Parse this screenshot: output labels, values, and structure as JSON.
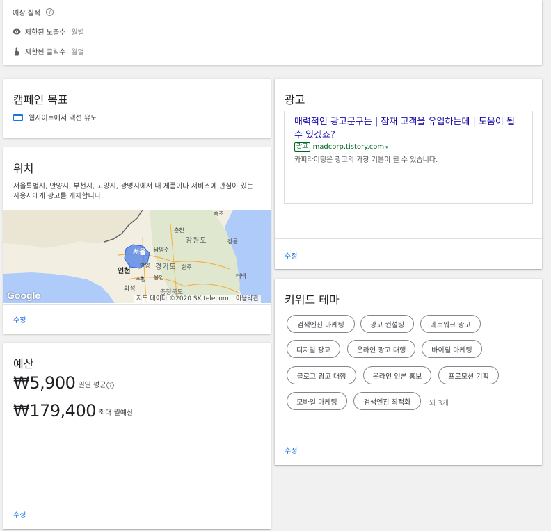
{
  "forecast": {
    "title": "예상 실적",
    "help": "?",
    "rows": [
      {
        "label": "제한된 노출수",
        "sub": "월별",
        "icon": "eye-icon"
      },
      {
        "label": "제한된 클릭수",
        "sub": "월별",
        "icon": "pointer-hand-icon"
      }
    ]
  },
  "goal": {
    "title": "캠페인 목표",
    "item": "웹사이트에서 액션 유도",
    "icon": "website-icon"
  },
  "location": {
    "title": "위치",
    "description": "서울특별시, 안양시, 부천시, 고양시, 광명시에서 내 제품이나 서비스에 관심이 있는 사용자에게 광고를 게재합니다.",
    "map": {
      "logo": "Google",
      "attribution": "지도 데이터 ©2020 SK telecom",
      "terms": "이용약관",
      "labels": [
        "속초",
        "춘천",
        "강원도",
        "강릉",
        "서울",
        "남양주",
        "인천",
        "안양",
        "경기도",
        "원주",
        "수원",
        "용인",
        "화성",
        "충청북도",
        "태백"
      ]
    },
    "edit": "수정"
  },
  "budget": {
    "title": "예산",
    "daily_amount": "₩5,900",
    "daily_note": "일일 평균",
    "help": "?",
    "monthly_amount": "₩179,400",
    "monthly_note": "최대 월예산",
    "edit": "수정"
  },
  "ad": {
    "title": "광고",
    "headline": "매력적인 광고문구는 | 잠재 고객을 유입하는데 | 도움이 될 수 있겠죠?",
    "badge": "광고",
    "url": "madcorp.tistory.com",
    "description": "카피라이팅은 광고의 가장 기본이 될 수 있습니다.",
    "edit": "수정"
  },
  "keywords": {
    "title": "키워드 테마",
    "chips": [
      "검색엔진 마케팅",
      "광고 컨설팅",
      "네트워크 광고",
      "디지털 광고",
      "온라인 광고 대행",
      "바이럴 마케팅",
      "블로그 광고 대행",
      "온라인 언론 홍보",
      "프로모션 기획",
      "모바일 마케팅",
      "검색엔진 최적화"
    ],
    "more": "외 3개",
    "edit": "수정"
  },
  "colors": {
    "link": "#1a73e8",
    "ad_headline": "#1a0dab",
    "ad_url": "#006621",
    "map_water": "#aecbfa",
    "map_land": "#f2efe2",
    "map_highlight": "#4a7ee8"
  }
}
